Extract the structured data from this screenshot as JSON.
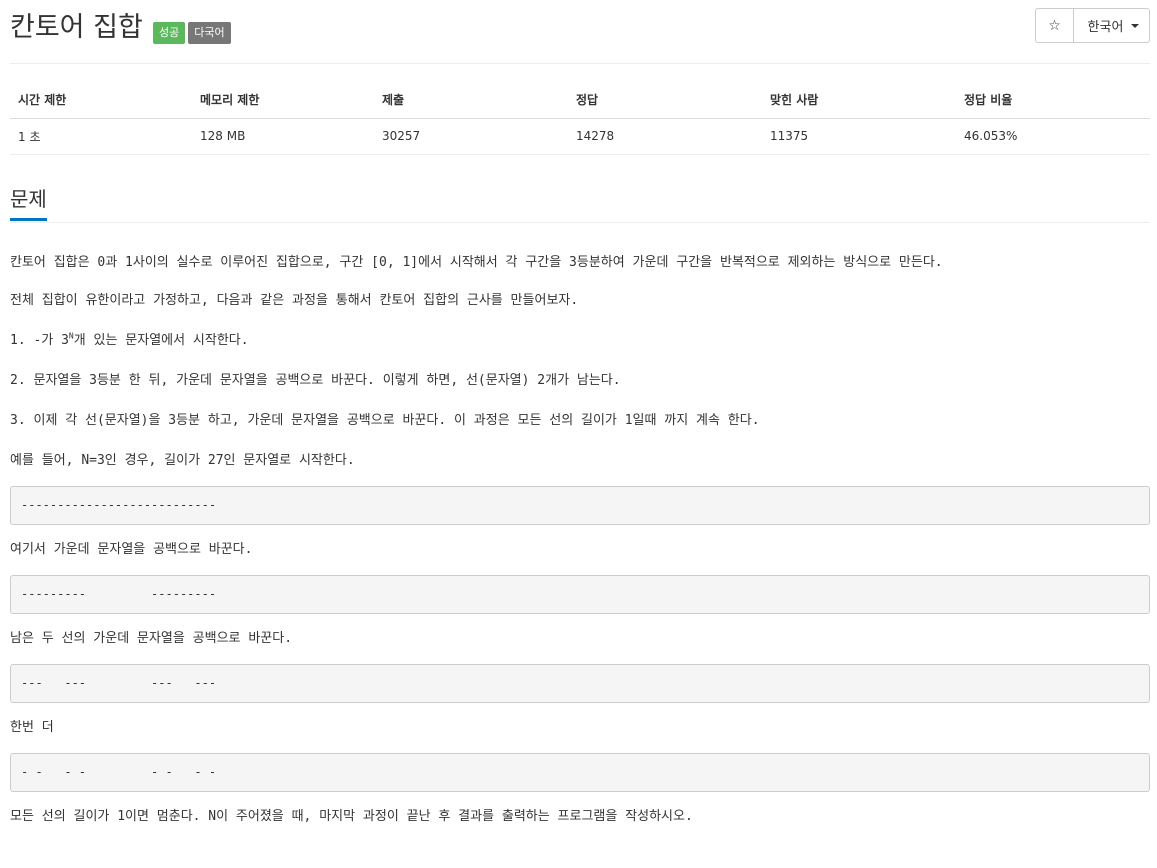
{
  "header": {
    "title": "칸토어 집합",
    "badges": [
      "성공",
      "다국어"
    ],
    "star_icon": "☆",
    "language": "한국어"
  },
  "info_table": {
    "headers": [
      "시간 제한",
      "메모리 제한",
      "제출",
      "정답",
      "맞힌 사람",
      "정답 비율"
    ],
    "values": [
      "1 초",
      "128 MB",
      "30257",
      "14278",
      "11375",
      "46.053%"
    ]
  },
  "section_title": "문제",
  "problem": {
    "p1": "칸토어 집합은 0과 1사이의 실수로 이루어진 집합으로, 구간 [0, 1]에서 시작해서 각 구간을 3등분하여 가운데 구간을 반복적으로 제외하는 방식으로 만든다.",
    "p2": "전체 집합이 유한이라고 가정하고, 다음과 같은 과정을 통해서 칸토어 집합의 근사를 만들어보자.",
    "p3_pre": "1. -가 3",
    "p3_sup": "N",
    "p3_post": "개 있는 문자열에서 시작한다.",
    "p4": "2. 문자열을 3등분 한 뒤, 가운데 문자열을 공백으로 바꾼다. 이렇게 하면, 선(문자열) 2개가 남는다.",
    "p5": "3. 이제 각 선(문자열)을 3등분 하고, 가운데 문자열을 공백으로 바꾼다. 이 과정은 모든 선의 길이가 1일때 까지 계속 한다.",
    "p6": "예를 들어, N=3인 경우, 길이가 27인 문자열로 시작한다.",
    "code1": "---------------------------",
    "p7": "여기서 가운데 문자열을 공백으로 바꾼다.",
    "code2": "---------         ---------",
    "p8": "남은 두 선의 가운데 문자열을 공백으로 바꾼다.",
    "code3": "---   ---         ---   ---",
    "p9": "한번 더",
    "code4": "- -   - -         - -   - -",
    "p10": "모든 선의 길이가 1이면 멈춘다. N이 주어졌을 때, 마지막 과정이 끝난 후 결과를 출력하는 프로그램을 작성하시오."
  }
}
